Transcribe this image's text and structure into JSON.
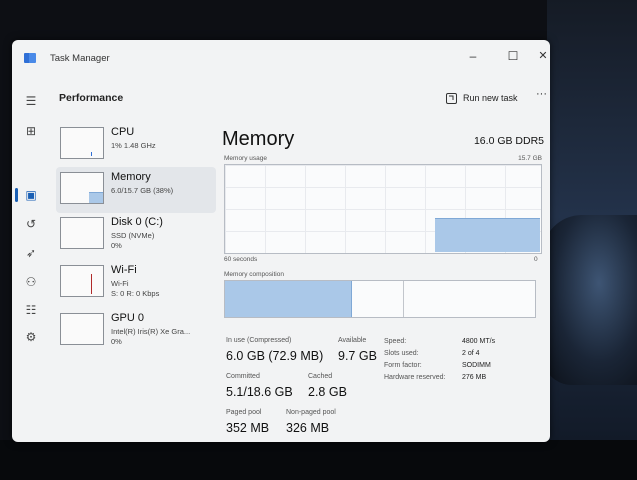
{
  "window": {
    "title": "Task Manager",
    "controls": [
      "–",
      "☐",
      "✕"
    ]
  },
  "nav": {
    "items": [
      {
        "name": "hamburger-icon",
        "glyph": "☰"
      },
      {
        "name": "processes-icon",
        "glyph": "⊞"
      },
      {
        "name": "performance-icon",
        "glyph": "▣"
      },
      {
        "name": "app-history-icon",
        "glyph": "↺"
      },
      {
        "name": "startup-apps-icon",
        "glyph": "➶"
      },
      {
        "name": "users-icon",
        "glyph": "⚇"
      },
      {
        "name": "details-icon",
        "glyph": "☷"
      },
      {
        "name": "services-icon",
        "glyph": "⚙"
      },
      {
        "name": "settings-icon",
        "glyph": "⚙"
      }
    ]
  },
  "header": {
    "title": "Performance",
    "run_new_task": "Run new task",
    "more": "···"
  },
  "resources": [
    {
      "id": "cpu",
      "name": "CPU",
      "line1": "1% 1.48 GHz",
      "line2": "",
      "selected": false
    },
    {
      "id": "memory",
      "name": "Memory",
      "line1": "6.0/15.7 GB (38%)",
      "line2": "",
      "selected": true
    },
    {
      "id": "disk",
      "name": "Disk 0 (C:)",
      "line1": "SSD (NVMe)",
      "line2": "0%",
      "selected": false
    },
    {
      "id": "wifi",
      "name": "Wi-Fi",
      "line1": "Wi-Fi",
      "line2": "S: 0 R: 0 Kbps",
      "selected": false
    },
    {
      "id": "gpu",
      "name": "GPU 0",
      "line1": "Intel(R) Iris(R) Xe Gra...",
      "line2": "0%",
      "selected": false
    }
  ],
  "detail": {
    "title": "Memory",
    "spec": "16.0 GB DDR5",
    "usage_label": "Memory usage",
    "usage_max": "15.7 GB",
    "time_left": "60 seconds",
    "time_right": "0",
    "composition_label": "Memory composition",
    "usage_fraction": 0.38,
    "stats": {
      "in_use_label": "In use (Compressed)",
      "in_use": "6.0 GB (72.9 MB)",
      "available_label": "Available",
      "available": "9.7 GB",
      "committed_label": "Committed",
      "committed": "5.1/18.6 GB",
      "cached_label": "Cached",
      "cached": "2.8 GB",
      "paged_label": "Paged pool",
      "paged": "352 MB",
      "nonpaged_label": "Non-paged pool",
      "nonpaged": "326 MB"
    },
    "specs": [
      {
        "label": "Speed:",
        "value": "4800 MT/s"
      },
      {
        "label": "Slots used:",
        "value": "2 of 4"
      },
      {
        "label": "Form factor:",
        "value": "SODIMM"
      },
      {
        "label": "Hardware reserved:",
        "value": "276 MB"
      }
    ]
  },
  "colors": {
    "accent": "#1a5fb4",
    "graph_fill": "#aac8e8",
    "graph_line": "#7fa8d6",
    "window_bg": "#f2f3f4"
  }
}
